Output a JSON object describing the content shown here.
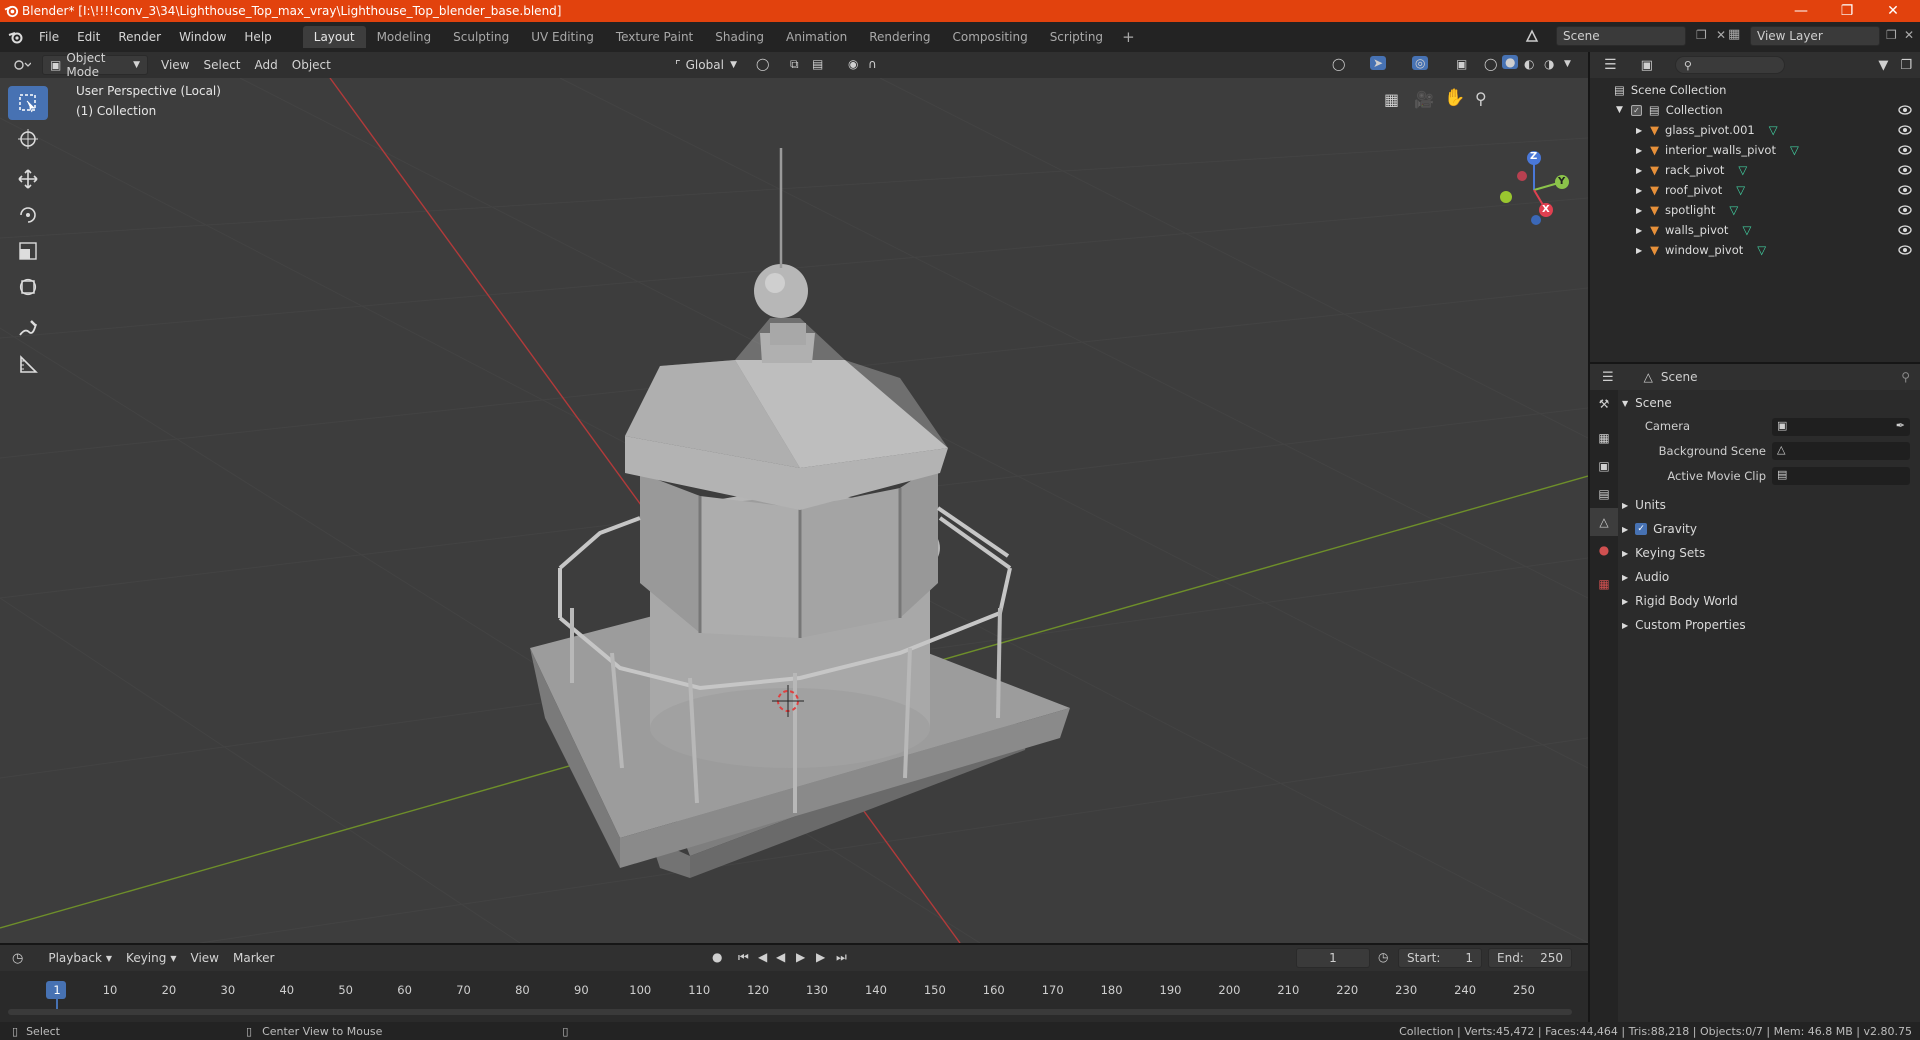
{
  "window": {
    "title": "Blender* [I:\\!!!!conv_3\\34\\Lighthouse_Top_max_vray\\Lighthouse_Top_blender_base.blend]",
    "controls": [
      "minimize",
      "maximize",
      "close"
    ]
  },
  "menu": {
    "items": [
      "File",
      "Edit",
      "Render",
      "Window",
      "Help"
    ],
    "workspaces": [
      "Layout",
      "Modeling",
      "Sculpting",
      "UV Editing",
      "Texture Paint",
      "Shading",
      "Animation",
      "Rendering",
      "Compositing",
      "Scripting"
    ],
    "active_workspace": "Layout",
    "scene_name": "Scene",
    "view_layer": "View Layer"
  },
  "viewport_header": {
    "mode": "Object Mode",
    "menus": [
      "View",
      "Select",
      "Add",
      "Object"
    ],
    "transform_orientation": "Global"
  },
  "viewport": {
    "perspective_label": "User Perspective (Local)",
    "collection_label": "(1) Collection",
    "gizmo_axes": [
      "Z",
      "Y",
      "X"
    ]
  },
  "outliner": {
    "root": "Scene Collection",
    "collection": "Collection",
    "objects": [
      "glass_pivot.001",
      "interior_walls_pivot",
      "rack_pivot",
      "roof_pivot",
      "spotlight",
      "walls_pivot",
      "window_pivot"
    ]
  },
  "properties": {
    "context": "Scene",
    "panel_title": "Scene",
    "fields": [
      {
        "label": "Camera"
      },
      {
        "label": "Background Scene"
      },
      {
        "label": "Active Movie Clip"
      }
    ],
    "sections": [
      "Units",
      "Gravity",
      "Keying Sets",
      "Audio",
      "Rigid Body World",
      "Custom Properties"
    ],
    "gravity_checked": true
  },
  "timeline": {
    "menus": [
      "Playback",
      "Keying",
      "View",
      "Marker"
    ],
    "current_frame": "1",
    "start_label": "Start:",
    "start": "1",
    "end_label": "End:",
    "end": "250",
    "ticks": [
      "1",
      "10",
      "20",
      "30",
      "40",
      "50",
      "60",
      "70",
      "80",
      "90",
      "100",
      "110",
      "120",
      "130",
      "140",
      "150",
      "160",
      "170",
      "180",
      "190",
      "200",
      "210",
      "220",
      "230",
      "240",
      "250"
    ]
  },
  "statusbar": {
    "left_action": "Select",
    "middle_action": "Center View to Mouse",
    "stats": "Collection | Verts:45,472 | Faces:44,464 | Tris:88,218 | Objects:0/7 | Mem: 46.8 MB | v2.80.75"
  },
  "colors": {
    "titlebar": "#e2420d",
    "accent": "#4772b3",
    "mesh_icon": "#e8913a",
    "data_icon": "#42d3a4"
  }
}
